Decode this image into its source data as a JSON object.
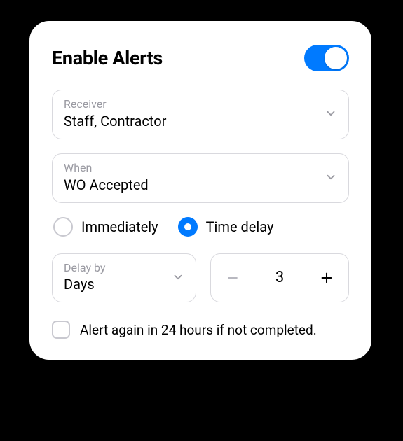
{
  "title": "Enable Alerts",
  "enabled": true,
  "receiver": {
    "label": "Receiver",
    "value": "Staff, Contractor"
  },
  "when": {
    "label": "When",
    "value": "WO Accepted"
  },
  "timing": {
    "options": [
      "Immediately",
      "Time delay"
    ],
    "selected": "Time delay"
  },
  "delay_by": {
    "label": "Delay by",
    "value": "Days"
  },
  "delay_amount": 3,
  "alert_again": {
    "checked": false,
    "label": "Alert again in 24 hours if not completed."
  },
  "colors": {
    "accent": "#007AFF"
  }
}
